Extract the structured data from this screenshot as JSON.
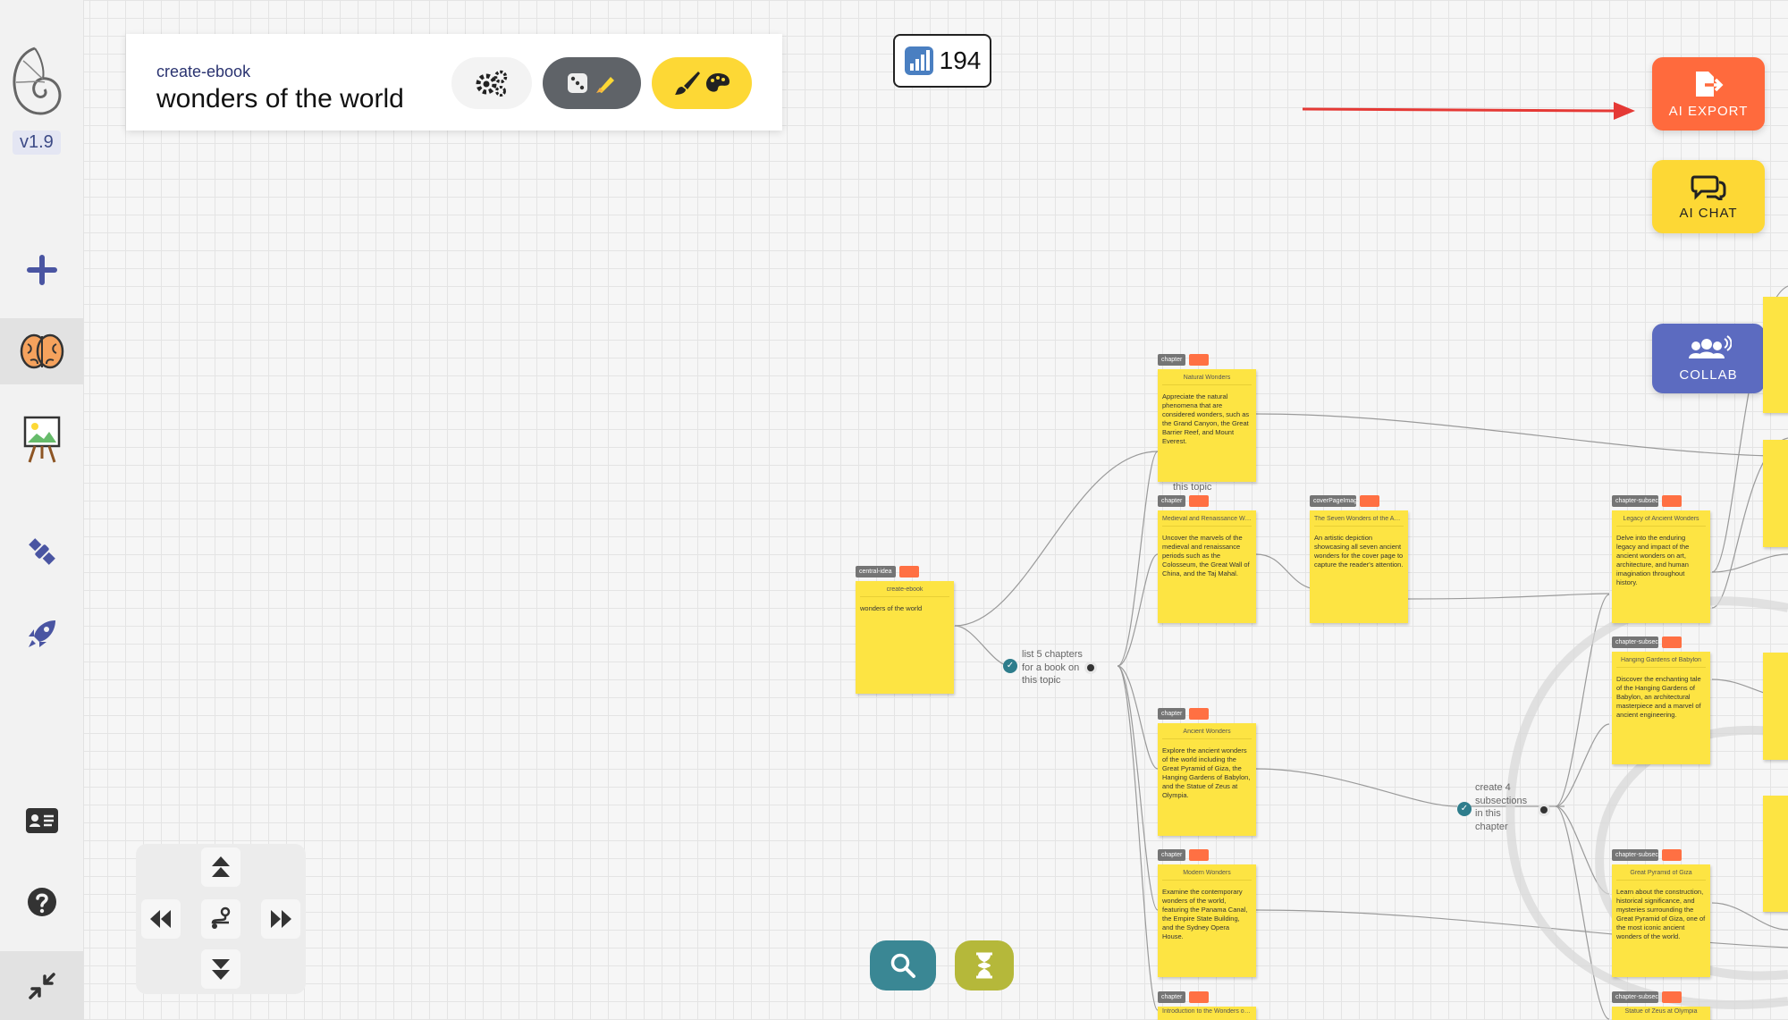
{
  "app": {
    "version": "v1.9"
  },
  "header": {
    "subtitle": "create-ebook",
    "title": "wonders of the world"
  },
  "counter": {
    "value": "194"
  },
  "actions": {
    "export_label": "AI EXPORT",
    "chat_label": "AI CHAT",
    "collab_label": "COLLAB"
  },
  "nodes": {
    "central": {
      "tag": "central-idea",
      "title": "create-ebook",
      "body": "wonders of the world"
    },
    "natural": {
      "tag": "chapter",
      "title": "Natural Wonders",
      "body": "Appreciate the natural phenomena that are considered wonders, such as the Grand Canyon, the Great Barrier Reef, and Mount Everest."
    },
    "medieval": {
      "tag": "chapter",
      "title": "Medieval and Renaissance Won...",
      "body": "Uncover the marvels of the medieval and renaissance periods such as the Colosseum, the Great Wall of China, and the Taj Mahal."
    },
    "cover": {
      "tag": "coverPageImage",
      "title": "The Seven Wonders of the Ancie...",
      "body": "An artistic depiction showcasing all seven ancient wonders for the cover page to capture the reader's attention."
    },
    "ancient": {
      "tag": "chapter",
      "title": "Ancient Wonders",
      "body": "Explore the ancient wonders of the world including the Great Pyramid of Giza, the Hanging Gardens of Babylon, and the Statue of Zeus at Olympia."
    },
    "modern": {
      "tag": "chapter",
      "title": "Modern Wonders",
      "body": "Examine the contemporary wonders of the world, featuring the Panama Canal, the Empire State Building, and the Sydney Opera House."
    },
    "intro": {
      "tag": "chapter",
      "title": "Introduction to the Wonders of t..."
    },
    "legacy": {
      "tag": "chapter-subsection",
      "title": "Legacy of Ancient Wonders",
      "body": "Delve into the enduring legacy and impact of the ancient wonders on art, architecture, and human imagination throughout history."
    },
    "babylon": {
      "tag": "chapter-subsection",
      "title": "Hanging Gardens of Babylon",
      "body": "Discover the enchanting tale of the Hanging Gardens of Babylon, an architectural masterpiece and a marvel of ancient engineering."
    },
    "pyramid": {
      "tag": "chapter-subsection",
      "title": "Great Pyramid of Giza",
      "body": "Learn about the construction, historical significance, and mysteries surrounding the Great Pyramid of Giza, one of the most iconic ancient wonders of the world."
    },
    "zeus": {
      "tag": "chapter-subsection",
      "title": "Statue of Zeus at Olympia"
    }
  },
  "prompts": {
    "chapters": "list 5 chapters for a book on this topic",
    "topic_fragment": "this topic",
    "subsections": "create 4 subsections in this chapter"
  }
}
